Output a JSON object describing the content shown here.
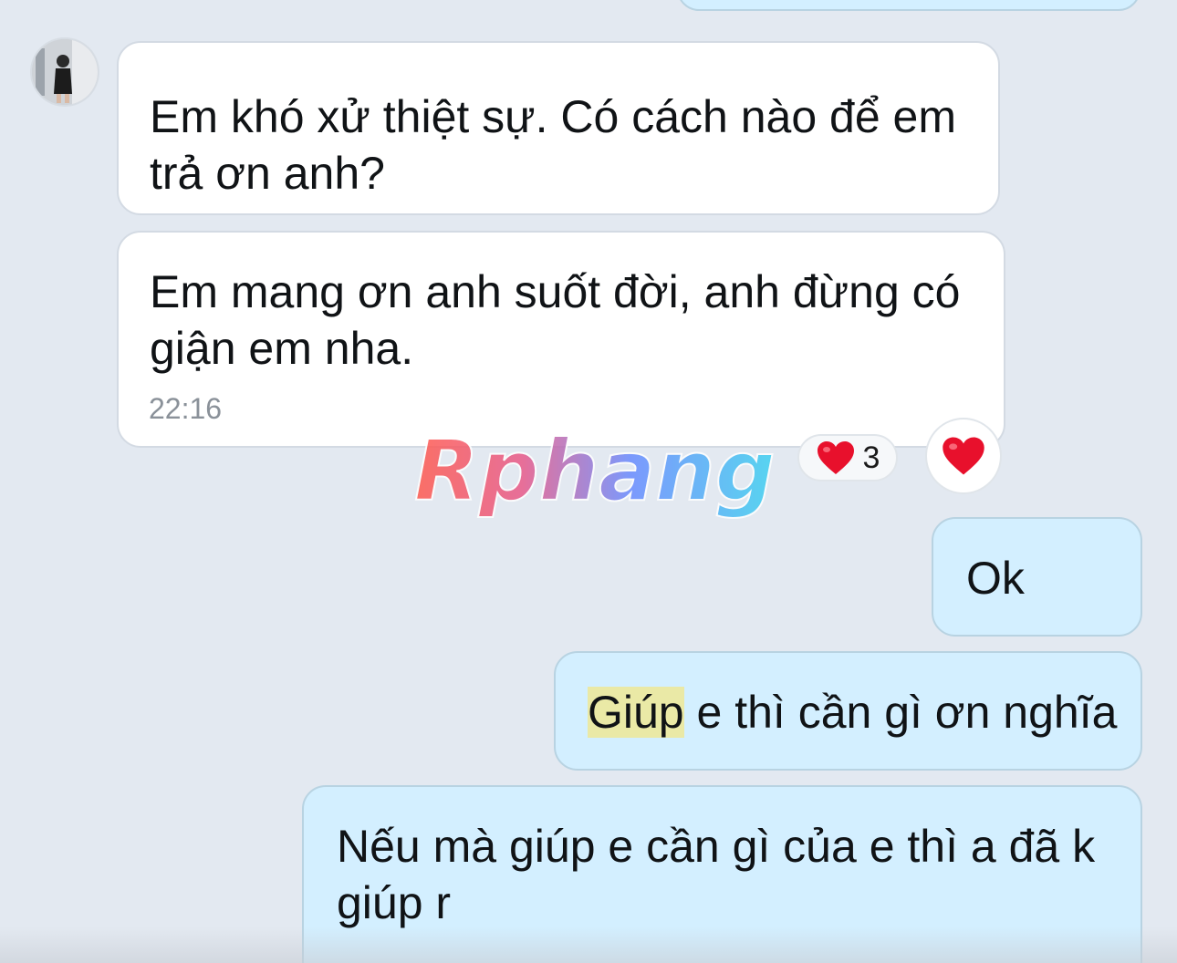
{
  "messages": {
    "incoming_1": "Em khó xử thiệt sự. Có cách nào để em trả ơn anh?",
    "incoming_2": "Em mang ơn anh suốt đời, anh đừng có giận em nha.",
    "incoming_2_time": "22:16",
    "outgoing_1": "Ok",
    "outgoing_2_highlight": "Giúp",
    "outgoing_2_rest": " e thì cần gì ơn nghĩa",
    "outgoing_3": "Nếu mà giúp e cần gì của e thì a đã k giúp r"
  },
  "reaction": {
    "emoji": "heart-icon",
    "count": "3"
  },
  "watermark": {
    "text": "Rphang"
  },
  "colors": {
    "background": "#e3e9f1",
    "incoming_bubble": "#ffffff",
    "outgoing_bubble": "#d3efff",
    "heart": "#e8102c",
    "search_highlight": "#eae9a6"
  }
}
